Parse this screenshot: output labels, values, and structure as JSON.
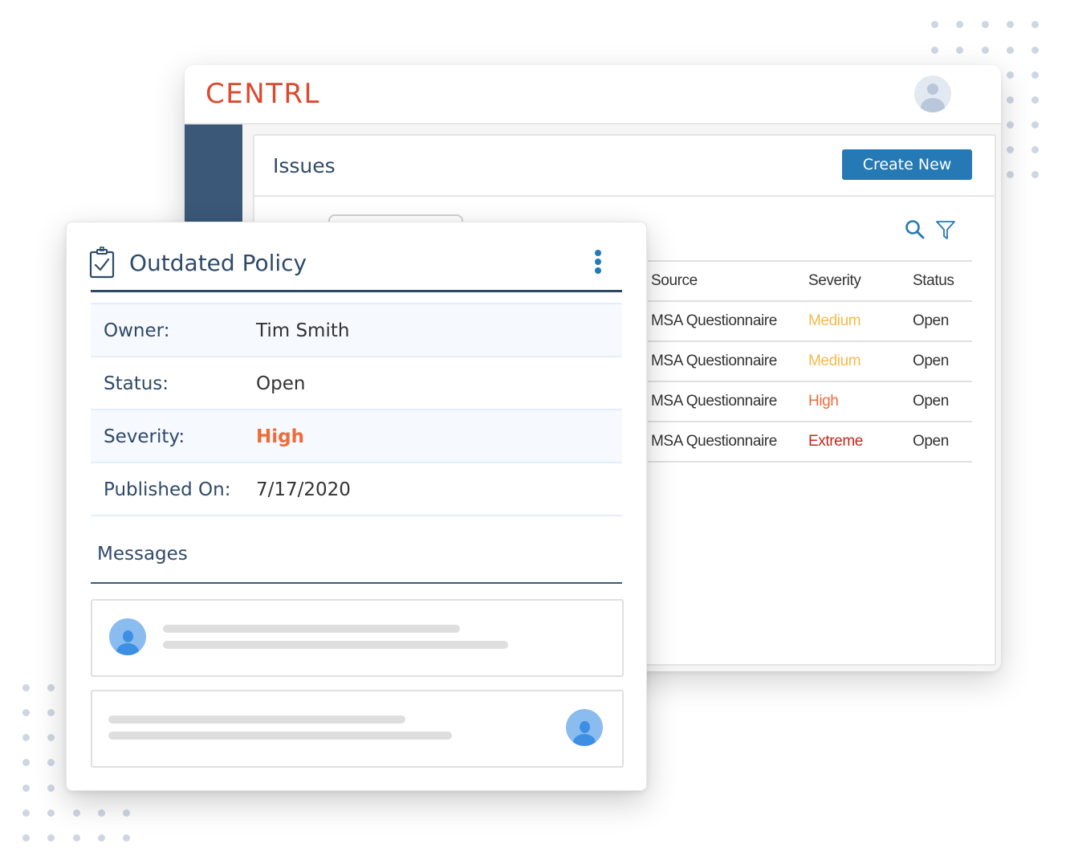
{
  "app": {
    "logo": "CENTRL",
    "user_avatar_icon": "user-avatar-icon"
  },
  "issues_panel": {
    "title": "Issues",
    "create_button": "Create New",
    "icons": [
      "search-icon",
      "filter-icon"
    ],
    "table": {
      "columns": [
        "Source",
        "Severity",
        "Status"
      ],
      "rows": [
        {
          "source": "MSA Questionnaire",
          "severity": "Medium",
          "status": "Open"
        },
        {
          "source": "MSA Questionnaire",
          "severity": "Medium",
          "status": "Open"
        },
        {
          "source": "MSA Questionnaire",
          "severity": "High",
          "status": "Open"
        },
        {
          "source": "MSA Questionnaire",
          "severity": "Extreme",
          "status": "Open"
        }
      ]
    }
  },
  "issue_card": {
    "title": "Outdated Policy",
    "title_icon": "clipboard-check-icon",
    "menu_icon": "more-vertical-icon",
    "details": [
      {
        "label": "Owner:",
        "value": "Tim Smith"
      },
      {
        "label": "Status:",
        "value": "Open"
      },
      {
        "label": "Severity:",
        "value": "High"
      },
      {
        "label": "Published On:",
        "value": "7/17/2020"
      }
    ],
    "messages_title": "Messages"
  },
  "colors": {
    "brand": "#dc4a2e",
    "primary": "#2579b4",
    "navy": "#2f4a69",
    "sidebar": "#3b5878",
    "severity_medium": "#f5b94a",
    "severity_high": "#ee6b3b",
    "severity_extreme": "#c0291c"
  }
}
